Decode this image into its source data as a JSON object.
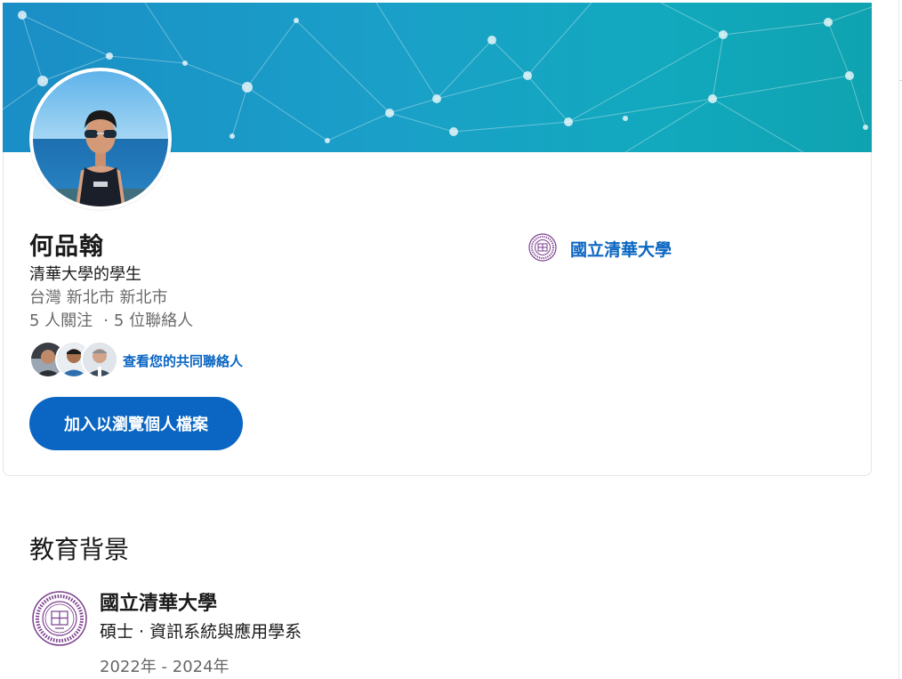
{
  "profile": {
    "name": "何品翰",
    "headline": "清華大學的學生",
    "location": "台灣 新北市 新北市",
    "followers": "5 人關注",
    "separator": "·",
    "connections": "5 位聯絡人",
    "mutual_connections_link": "查看您的共同聯絡人",
    "join_button": "加入以瀏覽個人檔案"
  },
  "top_school": {
    "name": "國立清華大學",
    "logo_icon": "university-seal-icon"
  },
  "education": {
    "section_title": "教育背景",
    "entries": [
      {
        "school": "國立清華大學",
        "degree": "碩士 · 資訊系統與應用學系",
        "dates": "2022年 - 2024年",
        "logo_icon": "university-seal-icon"
      }
    ]
  },
  "colors": {
    "accent": "#0a66c2",
    "banner_start": "#1a8ec6",
    "banner_end": "#0fa3b1",
    "seal": "#7b3f8f"
  }
}
